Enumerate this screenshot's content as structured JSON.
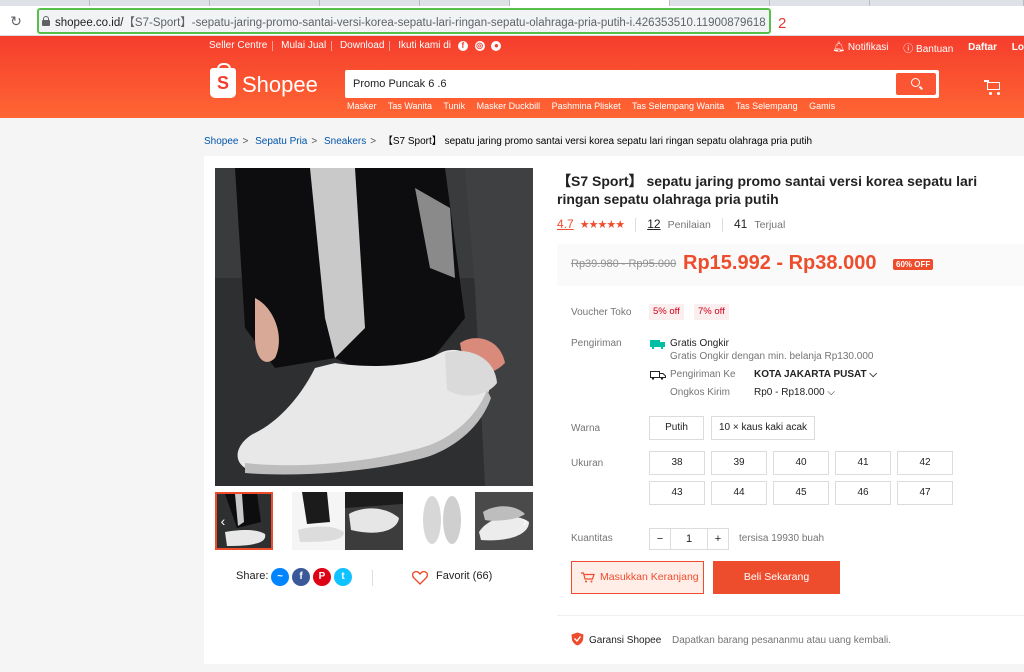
{
  "browser": {
    "url_host": "shopee.co.id/",
    "url_path": "【S7-Sport】-sepatu-jaring-promo-santai-versi-korea-sepatu-lari-ringan-sepatu-olahraga-pria-putih-i.426353510.11900879618",
    "annotation": "2"
  },
  "topnav": {
    "left": [
      "Seller Centre",
      "Mulai Jual",
      "Download",
      "Ikuti kami di"
    ],
    "right": [
      "Notifikasi",
      "Bantuan",
      "Daftar",
      "Lo"
    ]
  },
  "header": {
    "logo": "Shopee",
    "logo_letter": "S",
    "search_value": "Promo Puncak 6 .6",
    "suggestions": [
      "Masker",
      "Tas Wanita",
      "Tunik",
      "Masker Duckbill",
      "Pashmina Plisket",
      "Tas Selempang Wanita",
      "Tas Selempang",
      "Gamis"
    ]
  },
  "breadcrumb": [
    "Shopee",
    "Sepatu Pria",
    "Sneakers",
    "【S7 Sport】 sepatu jaring promo santai versi korea sepatu lari ringan sepatu olahraga pria putih"
  ],
  "product": {
    "title": "【S7 Sport】 sepatu jaring promo santai versi korea sepatu lari ringan sepatu olahraga pria putih",
    "rating": "4.7",
    "stars": "★★★★★",
    "rating_count": "12",
    "rating_label": "Penilaian",
    "sold_count": "41",
    "sold_label": "Terjual",
    "original_price": "Rp39.980 - Rp95.000",
    "price": "Rp15.992 - Rp38.000",
    "discount": "60% OFF"
  },
  "voucher": {
    "label": "Voucher Toko",
    "tags": [
      "5% off",
      "7% off"
    ]
  },
  "shipping": {
    "label": "Pengiriman",
    "free": "Gratis Ongkir",
    "free_sub": "Gratis Ongkir dengan min. belanja Rp130.000",
    "to_label": "Pengiriman Ke",
    "to_value": "KOTA JAKARTA PUSAT",
    "cost_label": "Ongkos Kirim",
    "cost_value": "Rp0 - Rp18.000"
  },
  "color": {
    "label": "Warna",
    "options": [
      "Putih",
      "10 × kaus kaki acak"
    ]
  },
  "size": {
    "label": "Ukuran",
    "options": [
      "38",
      "39",
      "40",
      "41",
      "42",
      "43",
      "44",
      "45",
      "46",
      "47"
    ]
  },
  "quantity": {
    "label": "Kuantitas",
    "minus": "−",
    "value": "1",
    "plus": "+",
    "stock": "tersisa 19930 buah"
  },
  "actions": {
    "add_to_cart": "Masukkan Keranjang",
    "buy_now": "Beli Sekarang"
  },
  "guarantee": {
    "title": "Garansi Shopee",
    "desc": "Dapatkan barang pesananmu atau uang kembali."
  },
  "share": {
    "label": "Share:",
    "icons": [
      "messenger-icon",
      "facebook-icon",
      "pinterest-icon",
      "twitter-icon"
    ]
  },
  "favorite": {
    "label": "Favorit (66)"
  },
  "colors": {
    "brand": "#ee4d2d",
    "url_highlight": "#58c04a"
  }
}
